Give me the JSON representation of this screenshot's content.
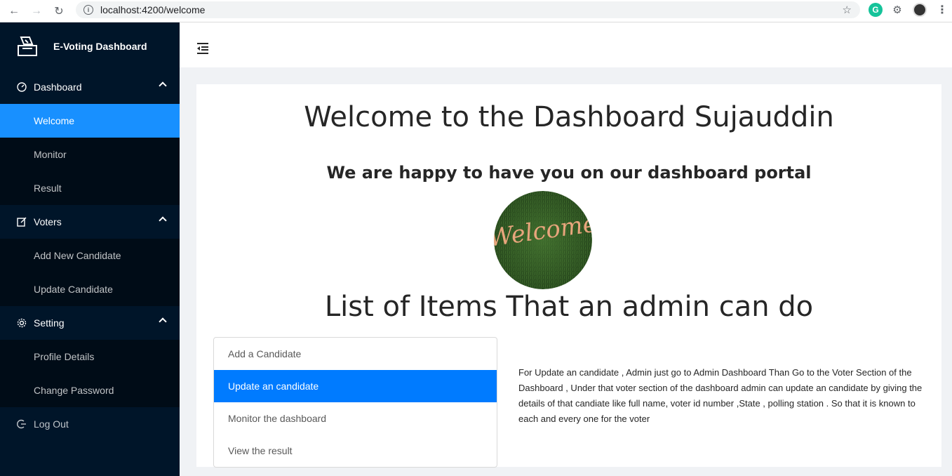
{
  "browser": {
    "url": "localhost:4200/welcome"
  },
  "sidebar": {
    "brand_title": "E-Voting Dashboard",
    "groups": [
      {
        "label": "Dashboard",
        "icon": "dashboard-icon",
        "items": [
          "Welcome",
          "Monitor",
          "Result"
        ]
      },
      {
        "label": "Voters",
        "icon": "form-icon",
        "items": [
          "Add New Candidate",
          "Update Candidate"
        ]
      },
      {
        "label": "Setting",
        "icon": "gear-icon",
        "items": [
          "Profile Details",
          "Change Password"
        ]
      }
    ],
    "active_item": "Welcome",
    "logout_label": "Log Out"
  },
  "main": {
    "title": "Welcome to the Dashboard Sujauddin",
    "subtitle": "We are happy to have you on our dashboard portal",
    "welcome_image_text": "Welcome",
    "list_title": "List of Items That an admin can do",
    "items": [
      "Add a Candidate",
      "Update an candidate",
      "Monitor the dashboard",
      "View the result"
    ],
    "active_item_index": 1,
    "detail": "For Update an candidate , Admin just go to Admin Dashboard Than Go to the Voter Section of the Dashboard , Under that voter section of the dashboard admin can update an candidate by giving the details of that candiate like full name, voter id number ,State , polling station . So that it is known to each and every one for the voter"
  },
  "colors": {
    "sidebar_bg": "#001529",
    "submenu_bg": "#000c17",
    "active_blue": "#1890ff",
    "list_active": "#007bff"
  }
}
